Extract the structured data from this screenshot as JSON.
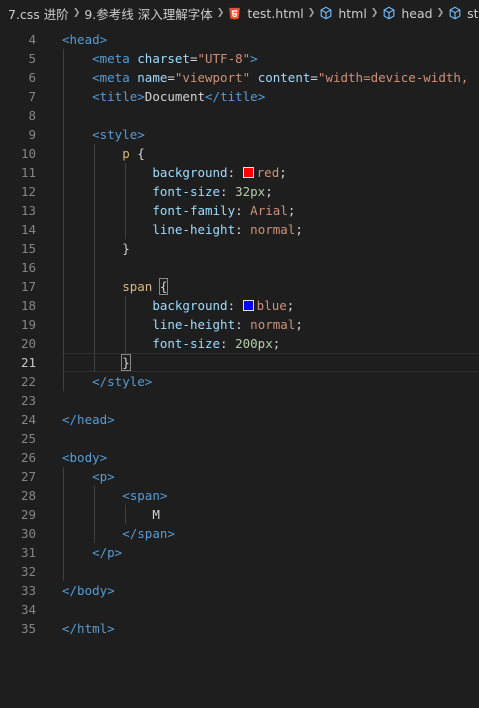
{
  "breadcrumb": {
    "items": [
      {
        "label": "7.css 进阶",
        "icon": null
      },
      {
        "label": "9.参考线 深入理解字体",
        "icon": null
      },
      {
        "label": "test.html",
        "icon": "html5-icon"
      },
      {
        "label": "html",
        "icon": "cube-icon"
      },
      {
        "label": "head",
        "icon": "cube-icon"
      },
      {
        "label": "st",
        "icon": "cube-icon"
      }
    ]
  },
  "colors": {
    "red_swatch": "#ff0000",
    "blue_swatch": "#0000ff"
  },
  "lines": [
    {
      "n": "4",
      "tokens": [
        [
          "tag",
          "<head>"
        ]
      ]
    },
    {
      "n": "5",
      "tokens": [
        [
          "ws",
          "    "
        ],
        [
          "tag",
          "<meta "
        ],
        [
          "attr",
          "charset"
        ],
        [
          "text",
          "="
        ],
        [
          "str",
          "\"UTF-8\""
        ],
        [
          "tag",
          ">"
        ]
      ]
    },
    {
      "n": "6",
      "tokens": [
        [
          "ws",
          "    "
        ],
        [
          "tag",
          "<meta "
        ],
        [
          "attr",
          "name"
        ],
        [
          "text",
          "="
        ],
        [
          "str",
          "\"viewport\""
        ],
        [
          "text",
          " "
        ],
        [
          "attr",
          "content"
        ],
        [
          "text",
          "="
        ],
        [
          "str",
          "\"width=device-width,"
        ]
      ]
    },
    {
      "n": "7",
      "tokens": [
        [
          "ws",
          "    "
        ],
        [
          "tag",
          "<title>"
        ],
        [
          "text",
          "Document"
        ],
        [
          "tag",
          "</title>"
        ]
      ]
    },
    {
      "n": "8",
      "tokens": []
    },
    {
      "n": "9",
      "tokens": [
        [
          "ws",
          "    "
        ],
        [
          "tag",
          "<style>"
        ]
      ]
    },
    {
      "n": "10",
      "tokens": [
        [
          "ws",
          "        "
        ],
        [
          "sel",
          "p"
        ],
        [
          "brace",
          " {"
        ]
      ]
    },
    {
      "n": "11",
      "tokens": [
        [
          "ws",
          "            "
        ],
        [
          "prop",
          "background"
        ],
        [
          "text",
          ": "
        ],
        [
          "swatch",
          "red"
        ],
        [
          "val",
          "red"
        ],
        [
          "text",
          ";"
        ]
      ]
    },
    {
      "n": "12",
      "tokens": [
        [
          "ws",
          "            "
        ],
        [
          "prop",
          "font-size"
        ],
        [
          "text",
          ": "
        ],
        [
          "num",
          "32px"
        ],
        [
          "text",
          ";"
        ]
      ]
    },
    {
      "n": "13",
      "tokens": [
        [
          "ws",
          "            "
        ],
        [
          "prop",
          "font-family"
        ],
        [
          "text",
          ": "
        ],
        [
          "val",
          "Arial"
        ],
        [
          "text",
          ";"
        ]
      ]
    },
    {
      "n": "14",
      "tokens": [
        [
          "ws",
          "            "
        ],
        [
          "prop",
          "line-height"
        ],
        [
          "text",
          ": "
        ],
        [
          "val",
          "normal"
        ],
        [
          "text",
          ";"
        ]
      ]
    },
    {
      "n": "15",
      "tokens": [
        [
          "ws",
          "        "
        ],
        [
          "brace",
          "}"
        ]
      ]
    },
    {
      "n": "16",
      "tokens": []
    },
    {
      "n": "17",
      "tokens": [
        [
          "ws",
          "        "
        ],
        [
          "sel",
          "span"
        ],
        [
          "text",
          " "
        ],
        [
          "bracem",
          "{"
        ]
      ]
    },
    {
      "n": "18",
      "tokens": [
        [
          "ws",
          "            "
        ],
        [
          "prop",
          "background"
        ],
        [
          "text",
          ": "
        ],
        [
          "swatch",
          "blue"
        ],
        [
          "val",
          "blue"
        ],
        [
          "text",
          ";"
        ]
      ]
    },
    {
      "n": "19",
      "tokens": [
        [
          "ws",
          "            "
        ],
        [
          "prop",
          "line-height"
        ],
        [
          "text",
          ": "
        ],
        [
          "val",
          "normal"
        ],
        [
          "text",
          ";"
        ]
      ]
    },
    {
      "n": "20",
      "tokens": [
        [
          "ws",
          "            "
        ],
        [
          "prop",
          "font-size"
        ],
        [
          "text",
          ": "
        ],
        [
          "num",
          "200px"
        ],
        [
          "text",
          ";"
        ]
      ]
    },
    {
      "n": "21",
      "tokens": [
        [
          "ws",
          "        "
        ],
        [
          "bracem",
          "}"
        ]
      ],
      "current": true
    },
    {
      "n": "22",
      "tokens": [
        [
          "ws",
          "    "
        ],
        [
          "tag",
          "</style>"
        ]
      ]
    },
    {
      "n": "23",
      "tokens": []
    },
    {
      "n": "24",
      "tokens": [
        [
          "tag",
          "</head>"
        ]
      ]
    },
    {
      "n": "25",
      "tokens": []
    },
    {
      "n": "26",
      "tokens": [
        [
          "tag",
          "<body>"
        ]
      ]
    },
    {
      "n": "27",
      "tokens": [
        [
          "ws",
          "    "
        ],
        [
          "tag",
          "<p>"
        ]
      ]
    },
    {
      "n": "28",
      "tokens": [
        [
          "ws",
          "        "
        ],
        [
          "tag",
          "<span>"
        ]
      ]
    },
    {
      "n": "29",
      "tokens": [
        [
          "ws",
          "            "
        ],
        [
          "text",
          "M"
        ]
      ]
    },
    {
      "n": "30",
      "tokens": [
        [
          "ws",
          "        "
        ],
        [
          "tag",
          "</span>"
        ]
      ]
    },
    {
      "n": "31",
      "tokens": [
        [
          "ws",
          "    "
        ],
        [
          "tag",
          "</p>"
        ]
      ]
    },
    {
      "n": "32",
      "tokens": []
    },
    {
      "n": "33",
      "tokens": [
        [
          "tag",
          "</body>"
        ]
      ]
    },
    {
      "n": "34",
      "tokens": []
    },
    {
      "n": "35",
      "tokens": [
        [
          "tag",
          "</html>"
        ]
      ]
    }
  ]
}
